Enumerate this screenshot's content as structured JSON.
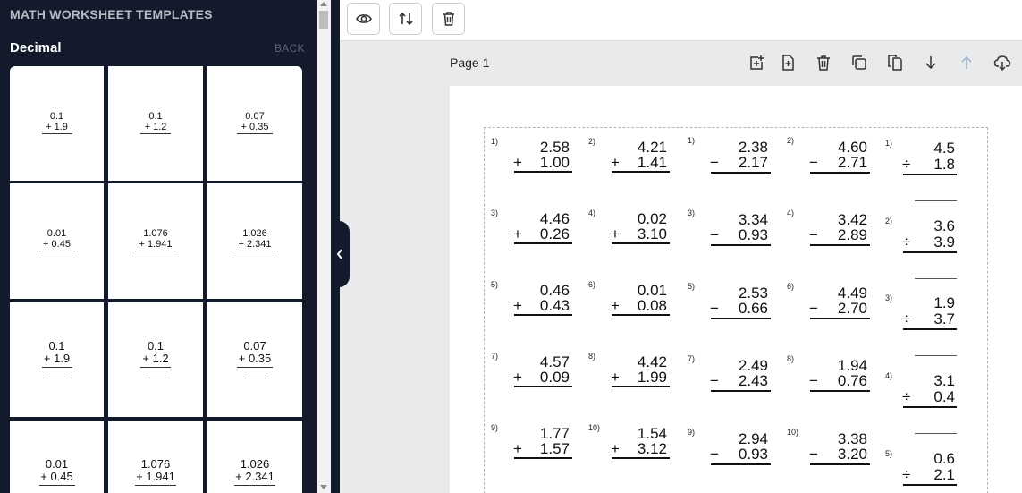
{
  "sidebar": {
    "title": "MATH WORKSHEET TEMPLATES",
    "subtitle": "Decimal",
    "back_label": "BACK",
    "cards": [
      {
        "top": "0.1",
        "bottom": "+ 1.9",
        "style": "small"
      },
      {
        "top": "0.1",
        "bottom": "+ 1.2",
        "style": "small"
      },
      {
        "top": "0.07",
        "bottom": "+ 0.35",
        "style": "small"
      },
      {
        "top": "0.01",
        "bottom": "+ 0.45",
        "style": "small"
      },
      {
        "top": "1.076",
        "bottom": "+ 1.941",
        "style": "small"
      },
      {
        "top": "1.026",
        "bottom": "+ 2.341",
        "style": "small"
      },
      {
        "top": "0.1",
        "bottom": "+ 1.9",
        "style": "blank"
      },
      {
        "top": "0.1",
        "bottom": "+ 1.2",
        "style": "blank"
      },
      {
        "top": "0.07",
        "bottom": "+ 0.35",
        "style": "blank"
      },
      {
        "top": "0.01",
        "bottom": "+ 0.45",
        "style": "large"
      },
      {
        "top": "1.076",
        "bottom": "+ 1.941",
        "style": "large"
      },
      {
        "top": "1.026",
        "bottom": "+ 2.341",
        "style": "large"
      }
    ]
  },
  "toolbar": {
    "buttons": [
      {
        "name": "preview-button",
        "icon": "eye-icon"
      },
      {
        "name": "sort-button",
        "icon": "sort-arrows-icon"
      },
      {
        "name": "delete-all-button",
        "icon": "trash-icon"
      }
    ]
  },
  "page": {
    "label": "Page 1",
    "actions": [
      {
        "name": "add-section-button",
        "icon": "add-box-icon"
      },
      {
        "name": "add-page-button",
        "icon": "add-file-icon"
      },
      {
        "name": "delete-page-button",
        "icon": "trash-icon"
      },
      {
        "name": "duplicate-page-button",
        "icon": "duplicate-icon"
      },
      {
        "name": "copy-page-button",
        "icon": "copy-icon"
      },
      {
        "name": "move-down-button",
        "icon": "arrow-down-icon"
      },
      {
        "name": "move-up-button",
        "icon": "arrow-up-icon"
      },
      {
        "name": "download-button",
        "icon": "cloud-download-icon"
      }
    ]
  },
  "worksheet": {
    "addition": [
      {
        "n": "1)",
        "a": "2.58",
        "b": "1.00"
      },
      {
        "n": "2)",
        "a": "4.21",
        "b": "1.41"
      },
      {
        "n": "3)",
        "a": "4.46",
        "b": "0.26"
      },
      {
        "n": "4)",
        "a": "0.02",
        "b": "3.10"
      },
      {
        "n": "5)",
        "a": "0.46",
        "b": "0.43"
      },
      {
        "n": "6)",
        "a": "0.01",
        "b": "0.08"
      },
      {
        "n": "7)",
        "a": "4.57",
        "b": "0.09"
      },
      {
        "n": "8)",
        "a": "4.42",
        "b": "1.99"
      },
      {
        "n": "9)",
        "a": "1.77",
        "b": "1.57"
      },
      {
        "n": "10)",
        "a": "1.54",
        "b": "3.12"
      }
    ],
    "subtraction": [
      {
        "n": "1)",
        "a": "2.38",
        "b": "2.17"
      },
      {
        "n": "2)",
        "a": "4.60",
        "b": "2.71"
      },
      {
        "n": "3)",
        "a": "3.34",
        "b": "0.93"
      },
      {
        "n": "4)",
        "a": "3.42",
        "b": "2.89"
      },
      {
        "n": "5)",
        "a": "2.53",
        "b": "0.66"
      },
      {
        "n": "6)",
        "a": "4.49",
        "b": "2.70"
      },
      {
        "n": "7)",
        "a": "2.49",
        "b": "2.43"
      },
      {
        "n": "8)",
        "a": "1.94",
        "b": "0.76"
      },
      {
        "n": "9)",
        "a": "2.94",
        "b": "0.93"
      },
      {
        "n": "10)",
        "a": "3.38",
        "b": "3.20"
      }
    ],
    "division": [
      {
        "n": "1)",
        "a": "4.5",
        "b": "1.8"
      },
      {
        "n": "2)",
        "a": "3.6",
        "b": "3.9"
      },
      {
        "n": "3)",
        "a": "1.9",
        "b": "3.7"
      },
      {
        "n": "4)",
        "a": "3.1",
        "b": "0.4"
      },
      {
        "n": "5)",
        "a": "0.6",
        "b": "2.1"
      }
    ],
    "operators": {
      "add": "+",
      "sub": "−",
      "div": "÷"
    }
  },
  "colors": {
    "sidebar_bg": "#121a2c",
    "page_bg": "#e9eaec",
    "paper": "#ffffff",
    "icon": "#333333",
    "icon_disabled": "#9ab4d0"
  }
}
